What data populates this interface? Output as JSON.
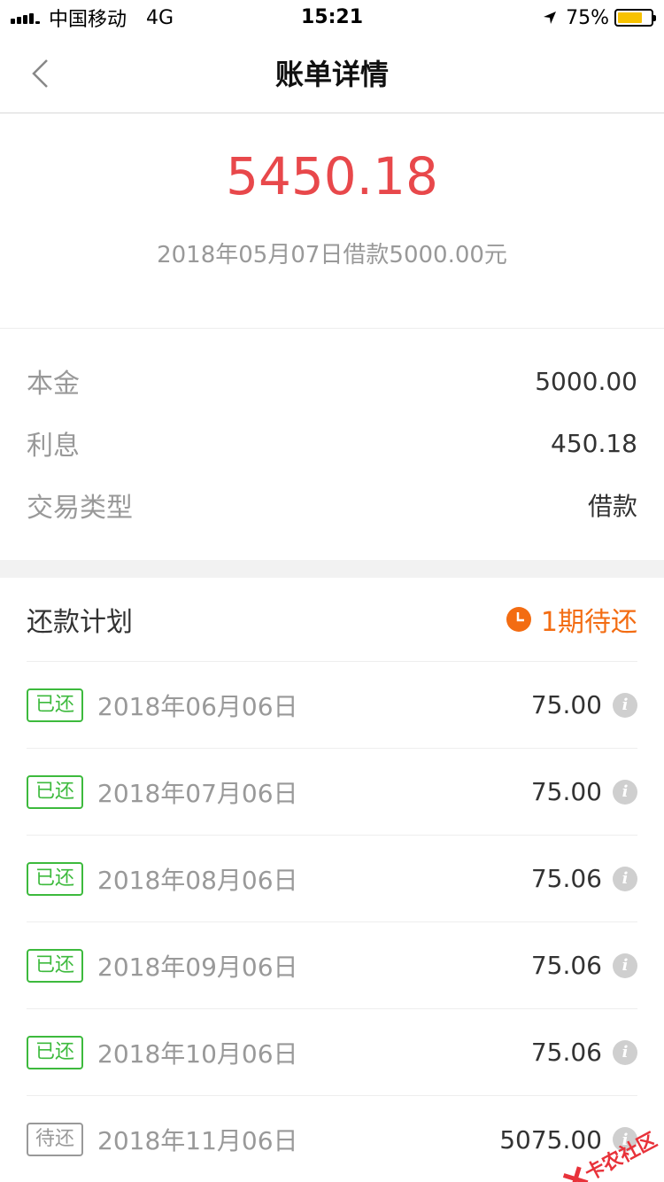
{
  "status_bar": {
    "carrier": "中国移动",
    "network": "4G",
    "time": "15:21",
    "battery_percent_text": "75%",
    "battery_level": 0.75
  },
  "nav": {
    "title": "账单详情"
  },
  "summary": {
    "total": "5450.18",
    "description": "2018年05月07日借款5000.00元"
  },
  "details": [
    {
      "label": "本金",
      "value": "5000.00"
    },
    {
      "label": "利息",
      "value": "450.18"
    },
    {
      "label": "交易类型",
      "value": "借款"
    }
  ],
  "plan": {
    "title": "还款计划",
    "status": "1期待还",
    "rows": [
      {
        "tag": "已还",
        "date": "2018年06月06日",
        "amount": "75.00"
      },
      {
        "tag": "已还",
        "date": "2018年07月06日",
        "amount": "75.00"
      },
      {
        "tag": "已还",
        "date": "2018年08月06日",
        "amount": "75.06"
      },
      {
        "tag": "已还",
        "date": "2018年09月06日",
        "amount": "75.06"
      },
      {
        "tag": "已还",
        "date": "2018年10月06日",
        "amount": "75.06"
      },
      {
        "tag": "待还",
        "date": "2018年11月06日",
        "amount": "5075.00"
      }
    ]
  },
  "watermark": {
    "text": "卡农社区"
  },
  "colors": {
    "accent_red": "#e8484b",
    "paid_green": "#3dba3d",
    "pending_orange": "#f36c12"
  }
}
